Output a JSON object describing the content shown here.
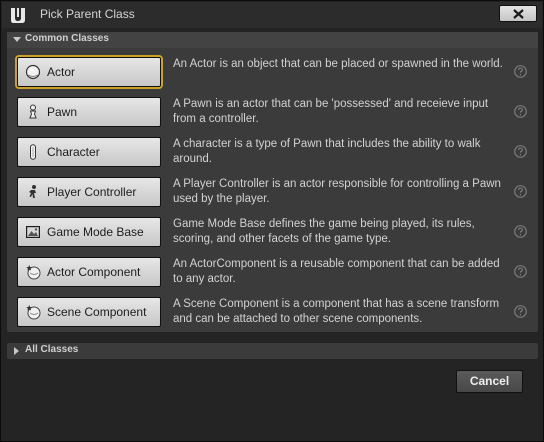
{
  "window": {
    "title": "Pick Parent Class"
  },
  "common_section": {
    "title": "Common Classes"
  },
  "classes": [
    {
      "label": "Actor",
      "icon": "actor-icon",
      "description": "An Actor is an object that can be placed or spawned in the world.",
      "selected": true
    },
    {
      "label": "Pawn",
      "icon": "pawn-icon",
      "description": "A Pawn is an actor that can be 'possessed' and receieve input from a controller."
    },
    {
      "label": "Character",
      "icon": "character-icon",
      "description": "A character is a type of Pawn that includes the ability to walk around."
    },
    {
      "label": "Player Controller",
      "icon": "player-controller-icon",
      "description": "A Player Controller is an actor responsible for controlling a Pawn used by the player."
    },
    {
      "label": "Game Mode Base",
      "icon": "game-mode-icon",
      "description": "Game Mode Base defines the game being played, its rules, scoring, and other facets of the game type."
    },
    {
      "label": "Actor Component",
      "icon": "actor-component-icon",
      "description": "An ActorComponent is a reusable component that can be added to any actor."
    },
    {
      "label": "Scene Component",
      "icon": "scene-component-icon",
      "description": "A Scene Component is a component that has a scene transform and can be attached to other scene components."
    }
  ],
  "all_section": {
    "title": "All Classes"
  },
  "footer": {
    "cancel_label": "Cancel"
  },
  "colors": {
    "window_bg": "#242424",
    "panel_bg": "#3b3b3b",
    "selection_outline": "#c9a227",
    "button_face": "#d6d6d6"
  }
}
